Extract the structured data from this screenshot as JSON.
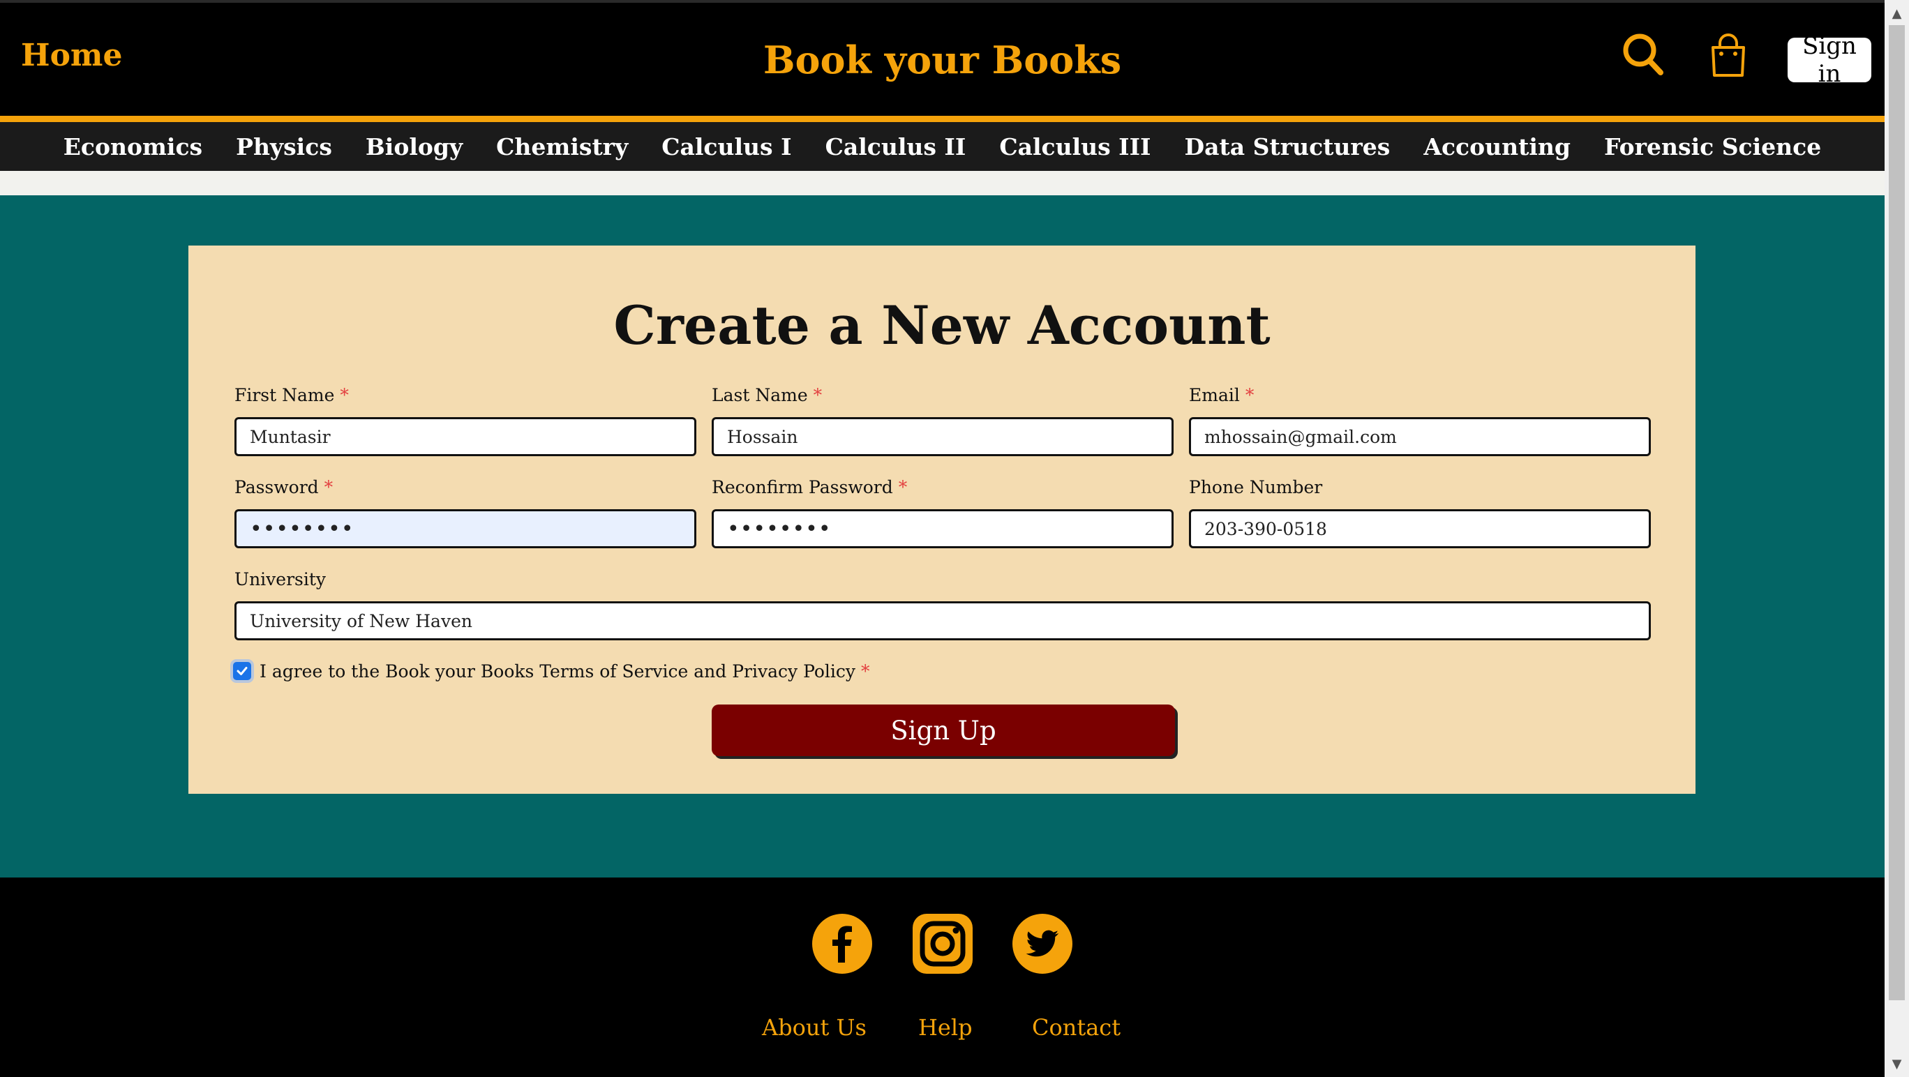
{
  "header": {
    "home_label": "Home",
    "brand": "Book your Books",
    "signin_label": "Sign in",
    "icons": [
      "search-icon",
      "shopping-bag-icon"
    ]
  },
  "nav": {
    "items": [
      "Economics",
      "Physics",
      "Biology",
      "Chemistry",
      "Calculus I",
      "Calculus II",
      "Calculus III",
      "Data Structures",
      "Accounting",
      "Forensic Science"
    ]
  },
  "form": {
    "title": "Create a New Account",
    "required_mark": "*",
    "first_name": {
      "label": "First Name",
      "value": "Muntasir"
    },
    "last_name": {
      "label": "Last Name",
      "value": "Hossain"
    },
    "email": {
      "label": "Email",
      "value": "mhossain@gmail.com"
    },
    "password": {
      "label": "Password",
      "value": "••••••••"
    },
    "reconfirm_password": {
      "label": "Reconfirm Password",
      "value": "••••••••"
    },
    "phone": {
      "label": "Phone Number",
      "value": "203-390-0518"
    },
    "university": {
      "label": "University",
      "value": "University of New Haven"
    },
    "agree_text": "I agree to the Book your Books Terms of Service and Privacy Policy",
    "agree_checked": true,
    "submit_label": "Sign Up"
  },
  "footer": {
    "social_icons": [
      "facebook-icon",
      "instagram-icon",
      "twitter-icon"
    ],
    "links": [
      "About Us",
      "Help",
      "Contact"
    ]
  },
  "colors": {
    "accent": "#f5a30b",
    "teal": "#036565",
    "card": "#f4dcb1",
    "signup_button": "#7a0000"
  }
}
